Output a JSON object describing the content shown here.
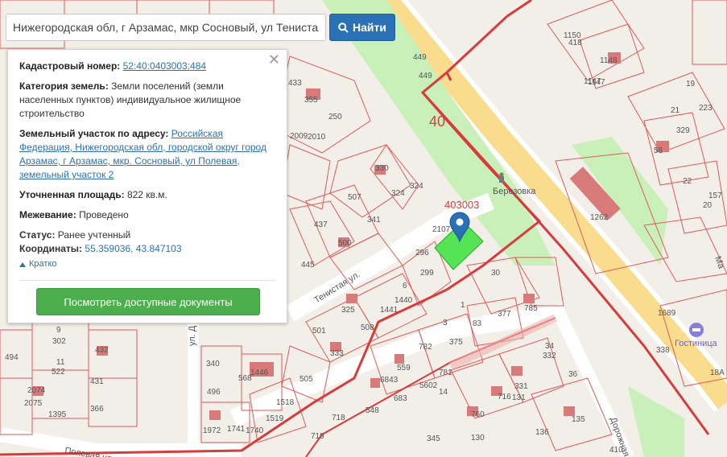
{
  "search": {
    "value": "Нижегородская обл, г Арзамас, мкр Сосновый, ул Тенистая",
    "button_label": "Найти"
  },
  "info": {
    "cadastral_label": "Кадастровый номер:",
    "cadastral_value": "52:40:0403003:484",
    "category_label": "Категория земель:",
    "category_value": "Земли поселений (земли населенных пунктов) индивидуальное жилищное строительство",
    "address_label": "Земельный участок по адресу:",
    "address_value": "Российская Федерация, Нижегородская обл, городской округ город Арзамас, г Арзамас, мкр. Сосновый, ул Полевая, земельный участок 2",
    "area_label": "Уточненная площадь:",
    "area_value": "822 кв.м.",
    "survey_label": "Межевание:",
    "survey_value": "Проведено",
    "status_label": "Статус:",
    "status_value": "Ранее учтенный",
    "coords_label": "Координаты:",
    "coords_value": "55.359036, 43.847103",
    "brief_label": "Кратко",
    "docs_button": "Посмотреть доступные документы"
  },
  "map": {
    "quarter_labels": [
      "40",
      "403003"
    ],
    "place_labels": [
      "Березовка",
      "Гостиница"
    ],
    "street_labels": [
      "Тенистая ул.",
      "Полевая ул.",
      "Дорожная ул.",
      "ул. Д",
      "Ма"
    ],
    "parcel_labels": [
      "449",
      "449",
      "418",
      "1150",
      "1147",
      "1148",
      "1147",
      "19",
      "223",
      "21",
      "329",
      "58",
      "22",
      "20",
      "157",
      "250",
      "355",
      "433",
      "2009",
      "2010",
      "330",
      "507",
      "324",
      "324",
      "341",
      "437",
      "500",
      "445",
      "1262",
      "296",
      "2107",
      "299",
      "6",
      "1440",
      "1441",
      "325",
      "501",
      "508",
      "333",
      "505",
      "30",
      "377",
      "785",
      "1",
      "83",
      "3",
      "375",
      "782",
      "781",
      "1689",
      "338",
      "18A",
      "34",
      "332",
      "36",
      "302",
      "9",
      "432",
      "522",
      "11",
      "431",
      "494",
      "2074",
      "2075",
      "1395",
      "366",
      "496",
      "340",
      "568",
      "1446",
      "1518",
      "1519",
      "1740",
      "1741",
      "1972",
      "719",
      "718",
      "548",
      "559",
      "6843",
      "5602",
      "683",
      "14",
      "760",
      "716",
      "131",
      "331",
      "135",
      "136",
      "345",
      "130",
      "410"
    ],
    "colors": {
      "background": "#f2efe9",
      "parcel_border": "#e05a5a",
      "quarter_border": "#d73b3b",
      "road": "#ffffff",
      "main_road": "#f9dc8e",
      "green": "#c8f0b8",
      "selected_parcel": "#55e455",
      "building": "#d97a7a",
      "marker": "#2a6fb8",
      "search_button": "#2a72b5",
      "docs_button": "#4cae4c",
      "link": "#2a72b5"
    }
  }
}
